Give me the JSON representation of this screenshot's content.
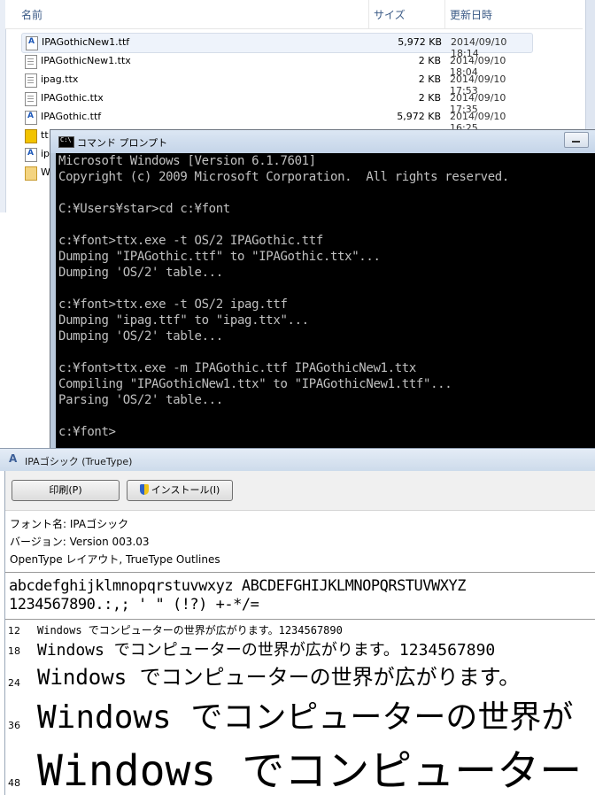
{
  "explorer": {
    "columns": {
      "name": "名前",
      "size": "サイズ",
      "date": "更新日時"
    },
    "files": [
      {
        "name": "IPAGothicNew1.ttf",
        "size": "5,972 KB",
        "date": "2014/09/10 18:14",
        "icon": "ttf-file-icon",
        "selected": true
      },
      {
        "name": "IPAGothicNew1.ttx",
        "size": "2 KB",
        "date": "2014/09/10 18:04",
        "icon": "text-file-icon"
      },
      {
        "name": "ipag.ttx",
        "size": "2 KB",
        "date": "2014/09/10 17:53",
        "icon": "text-file-icon"
      },
      {
        "name": "IPAGothic.ttx",
        "size": "2 KB",
        "date": "2014/09/10 17:35",
        "icon": "text-file-icon"
      },
      {
        "name": "IPAGothic.ttf",
        "size": "5,972 KB",
        "date": "2014/09/10 16:25",
        "icon": "ttf-file-icon"
      }
    ],
    "partial_rows": [
      {
        "name": "tt",
        "icon": "program-icon"
      },
      {
        "name": "ip",
        "icon": "ttf-file-icon"
      },
      {
        "name": "W",
        "icon": "folder-icon"
      }
    ]
  },
  "cmd": {
    "title": "コマンド プロンプト",
    "lines": [
      "Microsoft Windows [Version 6.1.7601]",
      "Copyright (c) 2009 Microsoft Corporation.  All rights reserved.",
      "",
      "C:¥Users¥star>cd c:¥font",
      "",
      "c:¥font>ttx.exe -t OS/2 IPAGothic.ttf",
      "Dumping \"IPAGothic.ttf\" to \"IPAGothic.ttx\"...",
      "Dumping 'OS/2' table...",
      "",
      "c:¥font>ttx.exe -t OS/2 ipag.ttf",
      "Dumping \"ipag.ttf\" to \"ipag.ttx\"...",
      "Dumping 'OS/2' table...",
      "",
      "c:¥font>ttx.exe -m IPAGothic.ttf IPAGothicNew1.ttx",
      "Compiling \"IPAGothicNew1.ttx\" to \"IPAGothicNew1.ttf\"...",
      "Parsing 'OS/2' table...",
      "",
      "c:¥font>"
    ]
  },
  "fontviewer": {
    "title": "IPAゴシック (TrueType)",
    "print_button": "印刷(P)",
    "install_button": "インストール(I)",
    "font_name": "フォント名: IPAゴシック",
    "version": "バージョン: Version 003.03",
    "layout": "OpenType レイアウト, TrueType Outlines",
    "charset_line1": "abcdefghijklmnopqrstuvwxyz ABCDEFGHIJKLMNOPQRSTUVWXYZ",
    "charset_line2": "1234567890.:,; ' \" (!?) +-*/=",
    "samples": [
      {
        "size": "12",
        "text": "Windows でコンピューターの世界が広がります。1234567890"
      },
      {
        "size": "18",
        "text": "Windows でコンピューターの世界が広がります。1234567890"
      },
      {
        "size": "24",
        "text": "Windows でコンピューターの世界が広がります。"
      },
      {
        "size": "36",
        "text": "Windows でコンピューターの世界が"
      },
      {
        "size": "48",
        "text": "Windows でコンピューター"
      }
    ]
  }
}
